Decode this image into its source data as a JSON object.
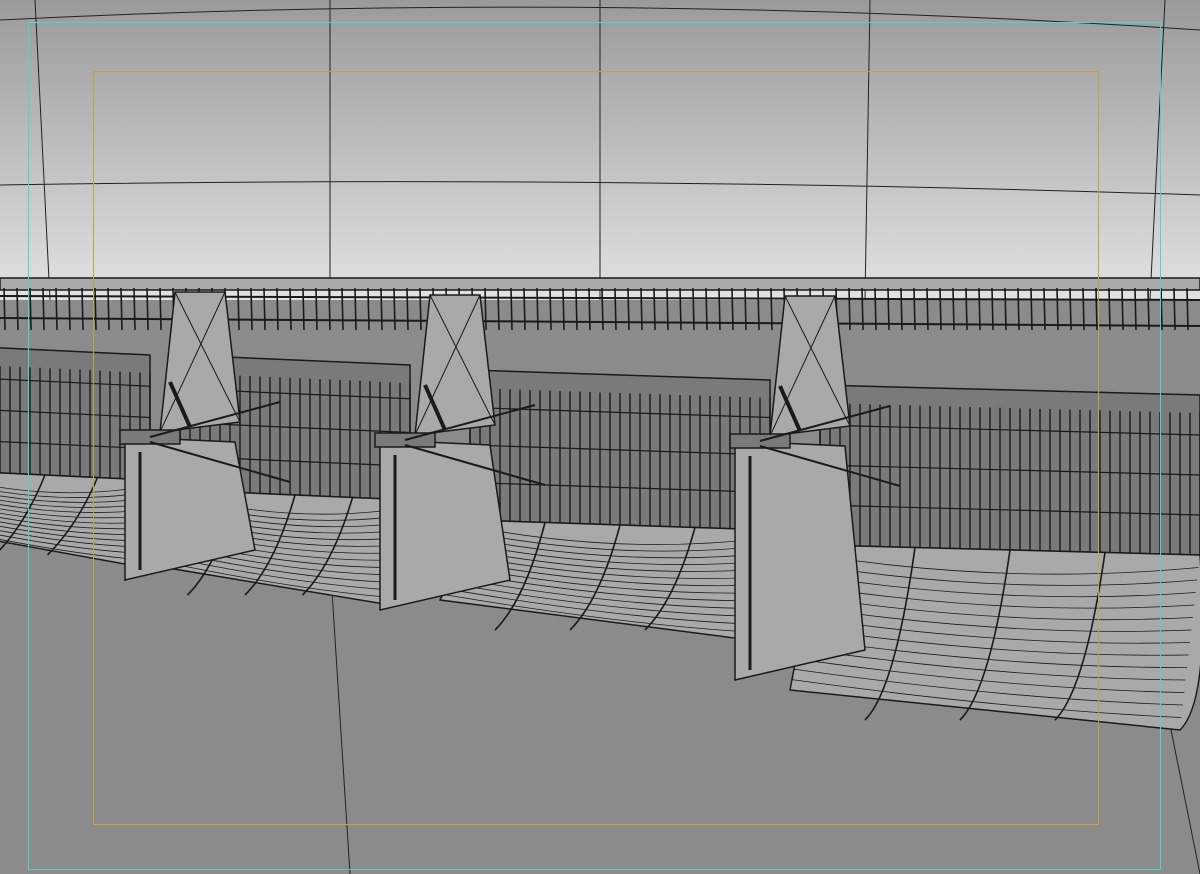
{
  "viewport": {
    "colors": {
      "sky_top": "#9a9a9a",
      "sky_bottom": "#e2e2e2",
      "ground": "#8b8b8b",
      "structure": "#a9a9a9",
      "structure_dark": "#7a7a7a",
      "wire": "#1a1a1a",
      "grid": "#222222",
      "safe_frame_outer": "#4fd3d0",
      "safe_frame_inner": "#c8a040"
    },
    "bays": 4,
    "piers": 3
  }
}
